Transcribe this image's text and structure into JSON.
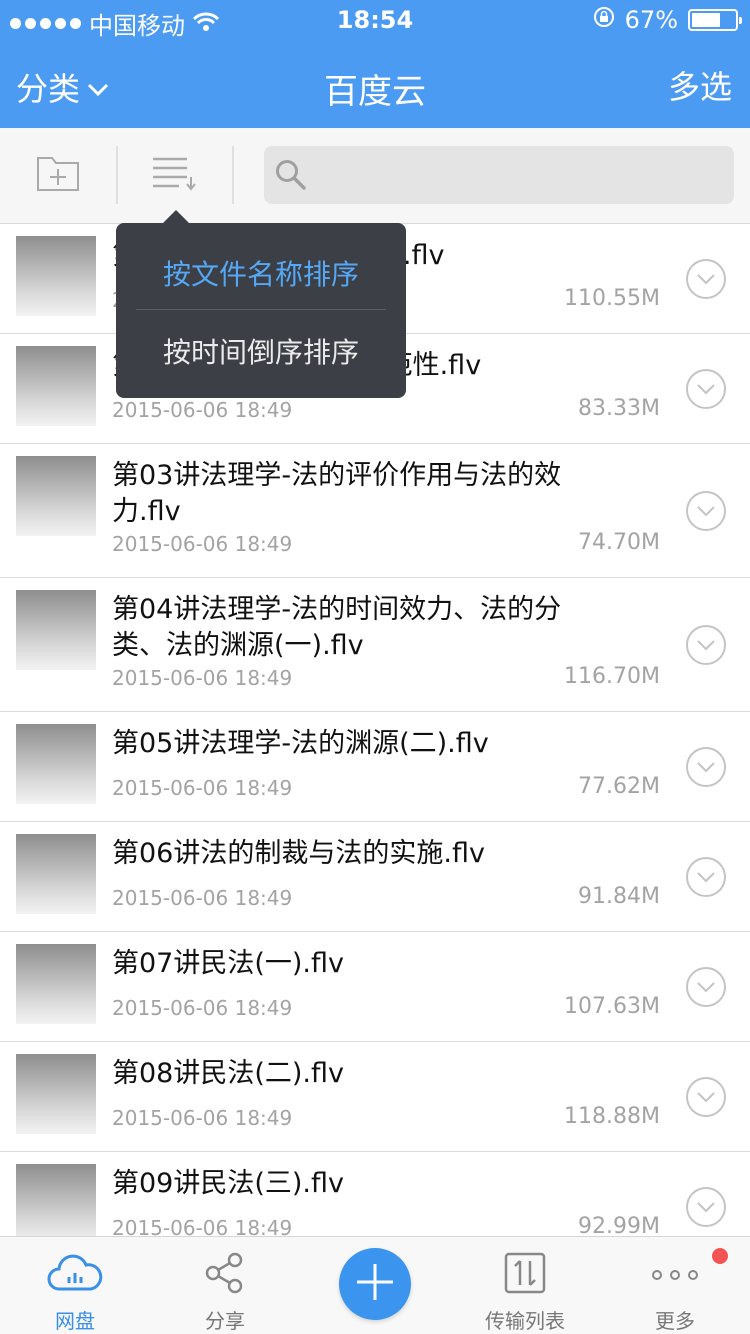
{
  "status_bar": {
    "carrier": "中国移动",
    "time": "18:54",
    "battery": "67%",
    "battery_level": 0.67,
    "icons": [
      "signal-dots-icon",
      "wifi-icon",
      "rotation-lock-icon",
      "battery-icon"
    ]
  },
  "nav": {
    "category_label": "分类",
    "title": "百度云",
    "multi_select_label": "多选"
  },
  "toolbar": {
    "icons": [
      "new-folder-icon",
      "sort-icon",
      "search-icon"
    ],
    "search_placeholder": ""
  },
  "sort_menu": {
    "options": [
      {
        "label": "按文件名称排序",
        "active": true
      },
      {
        "label": "按时间倒序排序",
        "active": false
      }
    ]
  },
  "files": [
    {
      "name": "第01讲法理学_考情分析.flv",
      "date": "2015-06-06 18:49",
      "size": "110.55M"
    },
    {
      "name": "第02讲_法理学-法的规范性.flv",
      "date": "2015-06-06 18:49",
      "size": "83.33M"
    },
    {
      "name": "第03讲法理学-法的评价作用与法的效力.flv",
      "date": "2015-06-06 18:49",
      "size": "74.70M"
    },
    {
      "name": "第04讲法理学-法的时间效力、法的分类、法的渊源(一).flv",
      "date": "2015-06-06 18:49",
      "size": "116.70M"
    },
    {
      "name": "第05讲法理学-法的渊源(二).flv",
      "date": "2015-06-06 18:49",
      "size": "77.62M"
    },
    {
      "name": "第06讲法的制裁与法的实施.flv",
      "date": "2015-06-06 18:49",
      "size": "91.84M"
    },
    {
      "name": "第07讲民法(一).flv",
      "date": "2015-06-06 18:49",
      "size": "107.63M"
    },
    {
      "name": "第08讲民法(二).flv",
      "date": "2015-06-06 18:49",
      "size": "118.88M"
    },
    {
      "name": "第09讲民法(三).flv",
      "date": "2015-06-06 18:49",
      "size": "92.99M"
    }
  ],
  "tabbar": {
    "tabs": [
      {
        "label": "网盘",
        "icon": "cloud-icon",
        "active": true
      },
      {
        "label": "分享",
        "icon": "share-icon",
        "active": false
      },
      {
        "label": "传输列表",
        "icon": "transfer-icon",
        "active": false
      },
      {
        "label": "更多",
        "icon": "more-dots-icon",
        "active": false
      }
    ],
    "add_button_icon": "plus-icon"
  },
  "colors": {
    "brand_blue": "#4c9bf2",
    "active_text": "#54a8f5",
    "popup_bg": "#3c3f45",
    "badge_red": "#f25454"
  }
}
